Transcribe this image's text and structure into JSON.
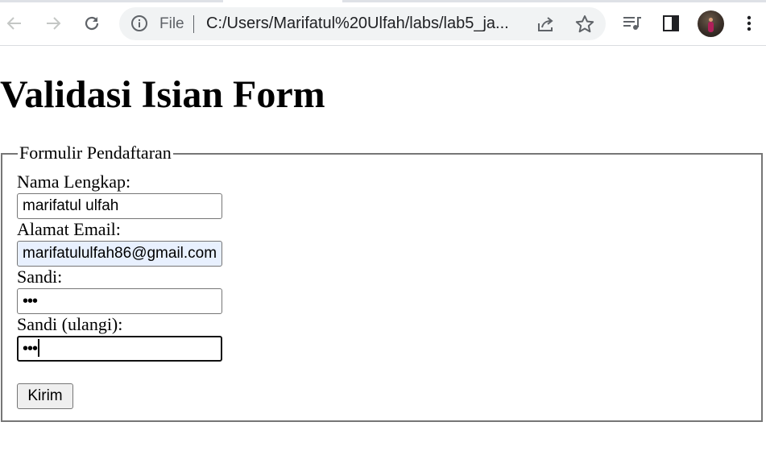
{
  "browser": {
    "scheme_label": "File",
    "url": "C:/Users/Marifatul%20Ulfah/labs/lab5_ja...",
    "icons": {
      "back": "arrow-left-icon",
      "forward": "arrow-right-icon",
      "reload": "reload-icon",
      "info": "info-icon",
      "share": "share-icon",
      "bookmark": "star-icon",
      "media": "media-queue-icon",
      "side_panel": "side-panel-icon",
      "menu": "kebab-menu-icon"
    },
    "colors": {
      "icon": "#5f6368",
      "omnibox_bg": "#f1f3f4",
      "autofill_bg": "#e8f0fe"
    }
  },
  "page": {
    "title": "Validasi Isian Form",
    "form": {
      "legend": "Formulir Pendaftaran",
      "fields": [
        {
          "label": "Nama Lengkap:",
          "value": "marifatul ulfah"
        },
        {
          "label": "Alamat Email:",
          "value": "marifatululfah86@gmail.com"
        },
        {
          "label": "Sandi:",
          "value": "•••"
        },
        {
          "label": "Sandi (ulangi):",
          "value": "•••"
        }
      ],
      "submit_label": "Kirim"
    }
  }
}
